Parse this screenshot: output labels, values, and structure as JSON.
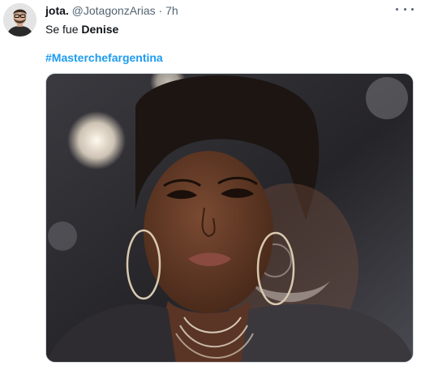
{
  "tweet": {
    "display_name": "jota.",
    "handle": "@JotagonzArias",
    "separator": "·",
    "time": "7h",
    "text_plain": "Se fue ",
    "text_bold": "Denise",
    "hashtag": "#Masterchefargentina",
    "more_icon": "more-horizontal-icon"
  },
  "colors": {
    "link": "#1d9bf0",
    "secondary_text": "#536471",
    "primary_text": "#0f1419"
  }
}
